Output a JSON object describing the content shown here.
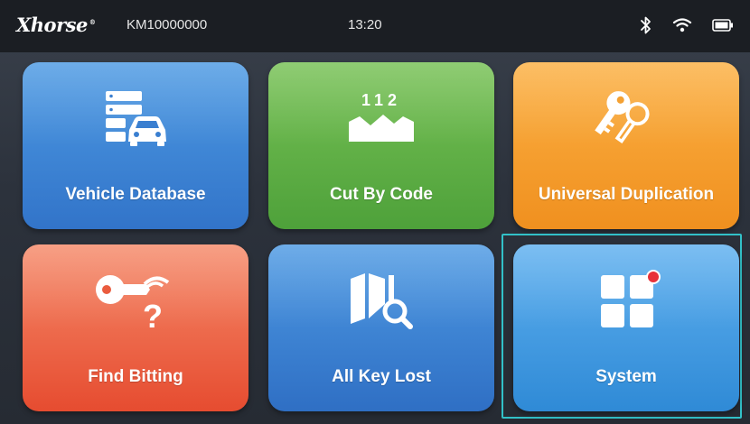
{
  "status_bar": {
    "brand": "Xhorse",
    "brand_mark": "®",
    "device_id": "KM10000000",
    "time": "13:20",
    "icons": [
      "bluetooth-icon",
      "wifi-icon",
      "battery-icon"
    ]
  },
  "menu": {
    "tiles": [
      {
        "label": "Vehicle Database",
        "icon": "vehicle-database-icon",
        "color": "#3b82d4"
      },
      {
        "label": "Cut By Code",
        "icon": "cut-by-code-icon",
        "code_text": "112",
        "color": "#5fb144"
      },
      {
        "label": "Universal Duplication",
        "icon": "key-duplication-icon",
        "color": "#f59f2c"
      },
      {
        "label": "Find Bitting",
        "icon": "find-bitting-icon",
        "color": "#ec6647"
      },
      {
        "label": "All Key Lost",
        "icon": "all-key-lost-icon",
        "color": "#3a7fd2"
      },
      {
        "label": "System",
        "icon": "system-grid-icon",
        "color": "#3d96de",
        "has_notification": true,
        "selected": true
      }
    ]
  },
  "colors": {
    "focus_ring": "#32c1c8",
    "notification_dot": "#e8323a",
    "status_bar_bg": "#1b1e23"
  }
}
